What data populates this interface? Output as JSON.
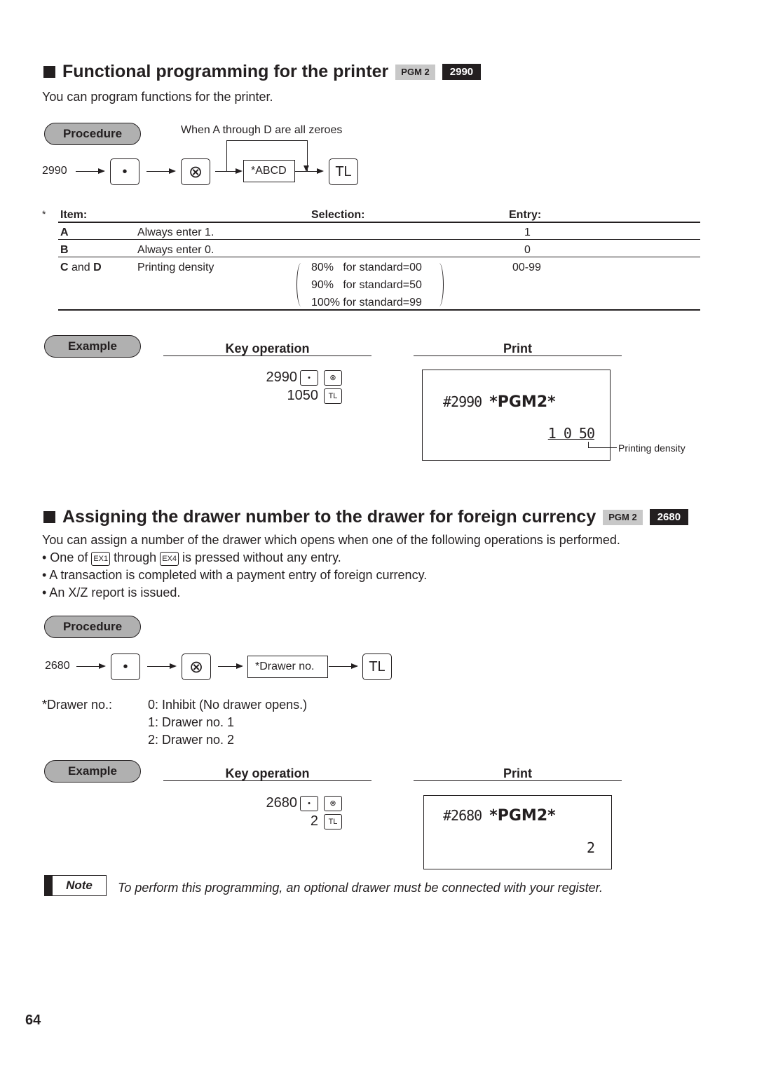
{
  "section1": {
    "title": "Functional programming for the printer",
    "pgm_badge": "PGM 2",
    "code_badge": "2990",
    "intro": "You can program functions for the printer.",
    "procedure_label": "Procedure",
    "flow": {
      "start": "2990",
      "key_dot": "•",
      "key_multiply": "⊗",
      "entry": "*ABCD",
      "key_total": "TL",
      "bypass_note": "When A through D are all zeroes"
    },
    "table": {
      "asterisk": "*",
      "headers": {
        "item": "Item:",
        "selection": "Selection:",
        "entry": "Entry:"
      },
      "rows": [
        {
          "item_bold": "A",
          "item_rest": "",
          "item_bold2": "",
          "desc": "Always enter 1.",
          "entry": "1"
        },
        {
          "item_bold": "B",
          "item_rest": "",
          "item_bold2": "",
          "desc": "Always enter 0.",
          "entry": "0"
        },
        {
          "item_bold": "C",
          "item_rest": " and ",
          "item_bold2": "D",
          "desc": "Printing density",
          "entry": "00-99",
          "options": [
            "80%   for standard=00",
            "90%   for standard=50",
            "100% for standard=99"
          ]
        }
      ]
    },
    "example": {
      "label": "Example",
      "key_operation_header": "Key operation",
      "print_header": "Print",
      "key_lines": [
        {
          "value": "2990",
          "keys": [
            "•",
            "⊗"
          ]
        },
        {
          "value": "1050",
          "keys": [
            "TL"
          ]
        }
      ],
      "print": {
        "line1_code": "#2990 ",
        "line1_pgm": "*PGM2*",
        "line2": "1 0 50",
        "annotation": "Printing density"
      }
    }
  },
  "section2": {
    "title": "Assigning the drawer number to the drawer for foreign currency",
    "pgm_badge": "PGM 2",
    "code_badge": "2680",
    "intro": "You can assign a number of the drawer which opens when one of the following operations is performed.",
    "bullets": {
      "b1_pre": "• One of ",
      "b1_key1": "EX1",
      "b1_mid": " through ",
      "b1_key2": "EX4",
      "b1_post": " is pressed without any entry.",
      "b2": "• A transaction is completed with a payment entry of foreign currency.",
      "b3": "• An X/Z report is issued."
    },
    "procedure_label": "Procedure",
    "flow": {
      "start": "2680",
      "key_dot": "•",
      "key_multiply": "⊗",
      "entry": "*Drawer no.",
      "key_total": "TL"
    },
    "drawer_no": {
      "label": "*Drawer no.:",
      "options": [
        "0: Inhibit (No drawer opens.)",
        "1: Drawer no. 1",
        "2: Drawer no. 2"
      ]
    },
    "example": {
      "label": "Example",
      "key_operation_header": "Key operation",
      "print_header": "Print",
      "key_lines": [
        {
          "value": "2680",
          "keys": [
            "•",
            "⊗"
          ]
        },
        {
          "value": "2",
          "keys": [
            "TL"
          ]
        }
      ],
      "print": {
        "line1_code": "#2680 ",
        "line1_pgm": "*PGM2*",
        "line2": "2"
      }
    }
  },
  "note": {
    "label": "Note",
    "text": "To perform this programming, an optional drawer must be connected with your register."
  },
  "page_number": "64"
}
